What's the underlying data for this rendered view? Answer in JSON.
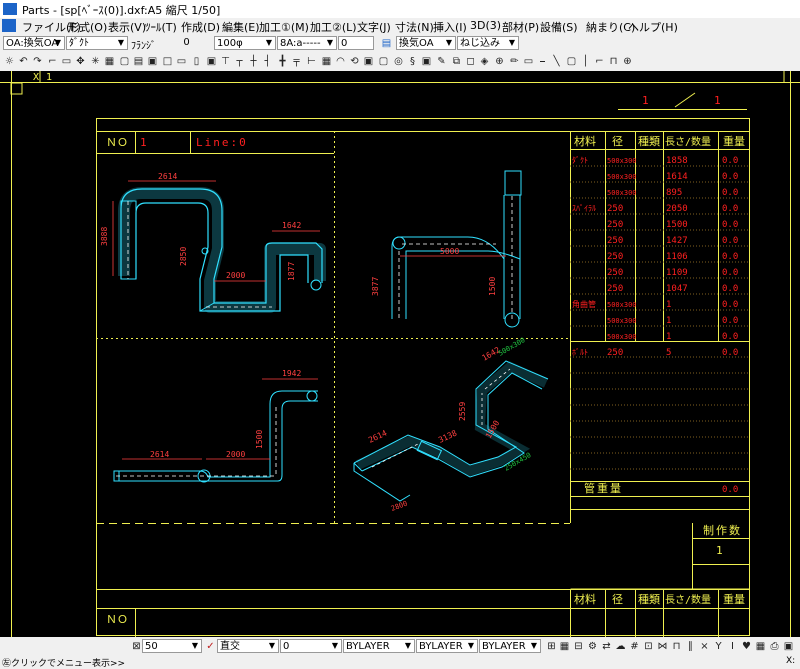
{
  "window": {
    "title": "Parts - [sp[ﾍﾞｰｽ(0)].dxf:A5 縮尺 1/50]"
  },
  "menu": [
    "ファイル(F)",
    "形式(O)",
    "表示(V)",
    "ﾂｰﾙ(T)",
    "作成(D)",
    "編集(E)",
    "加工①(M)",
    "加工②(L)",
    "文字(J)",
    "寸法(N)",
    "挿入(I)",
    "3D(3)",
    "部材(P)",
    "設備(S)",
    "納まり(C)",
    "ヘルプ(H)"
  ],
  "toolbar1": {
    "system": "OA:換気OA",
    "shape": "ﾀﾞｸﾄ",
    "angle_label": "ﾌﾗﾝｼﾞ",
    "angle_value": "0",
    "offset_value": "0",
    "size": "100φ",
    "line_type": "8A:a-----",
    "elev_value": "0",
    "use": "換気OA",
    "connection": "ねじ込み"
  },
  "canvas": {
    "ruler_x": "X",
    "ruler_one": "1",
    "sheet_page": "1",
    "sheet_total": "1",
    "no_label": "ＮＯ",
    "no_value": "1",
    "line_label": "Line:0",
    "table_headers": [
      "材料",
      "径",
      "種類",
      "長さ/数量",
      "重量"
    ],
    "rows": [
      {
        "material": "ﾀﾞｸﾄ",
        "size": "500x300",
        "length": "1858",
        "weight": "0.0"
      },
      {
        "material": "",
        "size": "500x300",
        "length": "1614",
        "weight": "0.0"
      },
      {
        "material": "",
        "size": "500x300",
        "length": "895",
        "weight": "0.0"
      },
      {
        "material": "ｽﾊﾟｲﾗﾙ",
        "size": "250",
        "length": "2050",
        "weight": "0.0"
      },
      {
        "material": "",
        "size": "250",
        "length": "1500",
        "weight": "0.0"
      },
      {
        "material": "",
        "size": "250",
        "length": "1427",
        "weight": "0.0"
      },
      {
        "material": "",
        "size": "250",
        "length": "1106",
        "weight": "0.0"
      },
      {
        "material": "",
        "size": "250",
        "length": "1109",
        "weight": "0.0"
      },
      {
        "material": "",
        "size": "250",
        "length": "1047",
        "weight": "0.0"
      },
      {
        "material": "角曲管",
        "size": "500x300",
        "length": "1",
        "weight": "0.0"
      },
      {
        "material": "",
        "size": "500x300",
        "length": "1",
        "weight": "0.0"
      },
      {
        "material": "",
        "size": "500x300",
        "length": "1",
        "weight": "0.0"
      },
      {
        "material": "ﾎﾞﾙﾄ",
        "size": "250",
        "length": "5",
        "weight": "0.0"
      }
    ],
    "pipe_weight_label": "管重量",
    "pipe_weight_value": "0.0",
    "production_label": "制作数",
    "production_value": "1",
    "no_label_2": "ＮＯ",
    "table_headers_2": [
      "材料",
      "径",
      "種類",
      "長さ/数量",
      "重量"
    ],
    "dims": {
      "front_top": "2614",
      "front_left": "3888",
      "front_mid": "2850",
      "front_bottom": "2000",
      "front_right_top": "1642",
      "front_right": "1877",
      "side_bottom": "5000",
      "side_left": "3877",
      "side_right": "1500",
      "plan_top": "1942",
      "plan_left": "2614",
      "plan_bottom": "2000",
      "plan_right": "1500",
      "iso_a": "2614",
      "iso_b": "3138",
      "iso_c": "2559",
      "iso_d": "1500",
      "iso_e": "1642",
      "iso_f": "500x300",
      "iso_g": "250x450",
      "iso_h": "2800"
    }
  },
  "toolbar3": {
    "scale": "50",
    "mode": "直交",
    "value": "0",
    "layer1": "BYLAYER",
    "layer2": "BYLAYER",
    "layer3": "BYLAYER"
  },
  "status": {
    "message": "㊧クリックでメニュー表示>>",
    "coord_label": "X:"
  },
  "colors": {
    "frame": "#f0f050",
    "red": "#ff2020",
    "cyan": "#30e0ff",
    "white": "#ffffff",
    "dim": "#ff4040"
  }
}
